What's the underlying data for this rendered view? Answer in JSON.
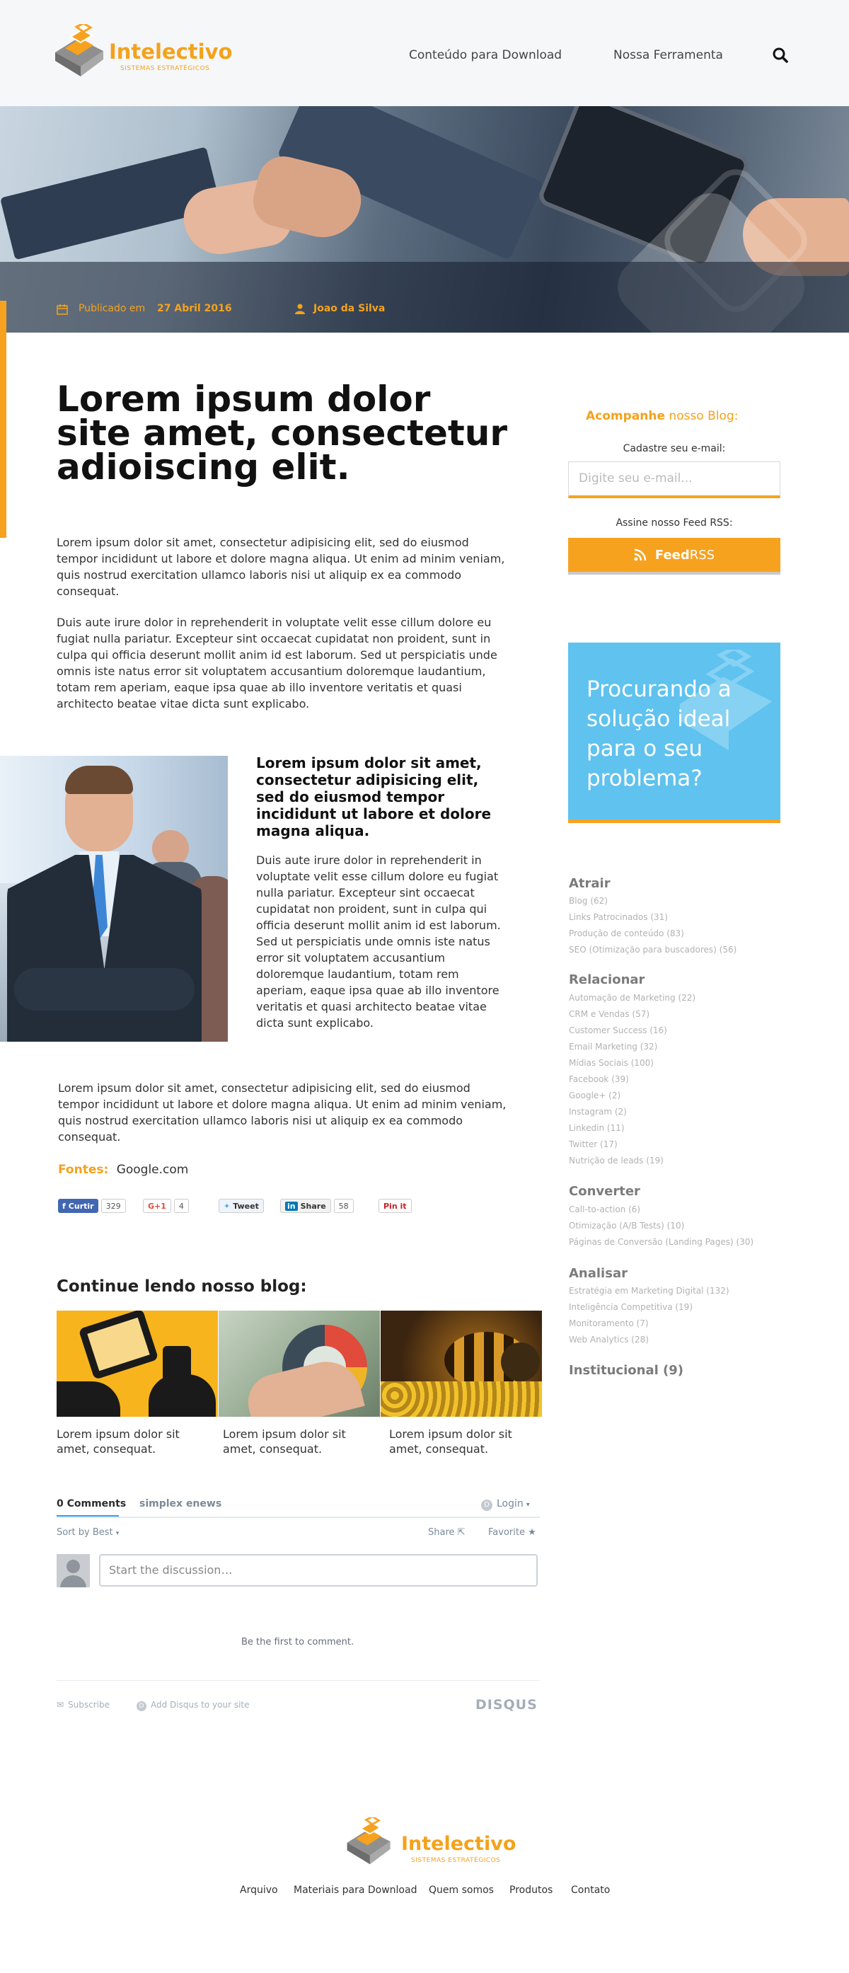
{
  "header": {
    "logo_name": "Intelectivo",
    "logo_tagline": "SISTEMAS ESTRATÉGICOS",
    "nav": [
      "Conteúdo para Download",
      "Nossa Ferramenta"
    ]
  },
  "hero": {
    "published_prefix": "Publicado em",
    "published_date": "27 Abril 2016",
    "author": "Joao da Silva"
  },
  "article": {
    "title_bold": "Lorem ipsum",
    "title_rest": " dolor site amet, consectetur adioiscing elit.",
    "p1": "Lorem ipsum dolor sit amet, consectetur adipisicing elit, sed do eiusmod tempor incididunt ut labore et dolore magna aliqua. Ut enim ad minim veniam, quis nostrud exercitation ullamco laboris nisi ut aliquip ex ea commodo consequat.",
    "p2": "Duis aute irure dolor in reprehenderit in voluptate velit esse cillum dolore eu fugiat nulla pariatur. Excepteur sint occaecat cupidatat non proident, sunt in culpa qui officia deserunt mollit anim id est laborum. Sed ut perspiciatis unde omnis iste natus error sit voluptatem accusantium doloremque laudantium, totam rem aperiam, eaque ipsa quae ab illo inventore veritatis et quasi architecto beatae vitae dicta sunt explicabo.",
    "lead": "Lorem ipsum dolor sit amet, consectetur adipisicing elit, sed do eiusmod tempor incididunt ut labore et dolore magna aliqua.",
    "p3": "Duis aute irure dolor in reprehenderit in voluptate velit esse cillum dolore eu fugiat nulla pariatur. Excepteur sint occaecat cupidatat non proident, sunt in culpa qui officia deserunt mollit anim id est laborum. Sed ut perspiciatis unde omnis iste natus error sit voluptatem accusantium doloremque laudantium, totam rem aperiam, eaque ipsa quae ab illo inventore veritatis et quasi architecto beatae vitae dicta sunt explicabo.",
    "p4": "Lorem ipsum dolor sit amet, consectetur adipisicing elit, sed do eiusmod tempor incididunt ut labore et dolore magna aliqua. Ut enim ad minim veniam, quis nostrud exercitation ullamco laboris nisi ut aliquip ex ea commodo consequat.",
    "sources_label": "Fontes:",
    "sources_value": "Google.com"
  },
  "social": {
    "facebook_label": "Curtir",
    "facebook_count": "329",
    "gplus_label": "G+1",
    "gplus_count": "4",
    "tweet_label": "Tweet",
    "linkedin_label": "Share",
    "linkedin_count": "58",
    "pinterest_label": "Pin it"
  },
  "related": {
    "heading": "Continue lendo nosso blog:",
    "captions": [
      "Lorem ipsum dolor sit amet, consequat.",
      "Lorem ipsum dolor sit amet, consequat.",
      "Lorem ipsum dolor sit amet, consequat."
    ]
  },
  "comments": {
    "tab_count": "0 Comments",
    "tab_site": "simplex enews",
    "login": "Login",
    "sort": "Sort by Best",
    "share": "Share",
    "favorite": "Favorite",
    "placeholder": "Start the discussion…",
    "empty": "Be the first to comment.",
    "subscribe": "Subscribe",
    "add_disqus": "Add Disqus to your site",
    "brand": "DISQUS"
  },
  "sidebar": {
    "follow_bold": "Acompanhe",
    "follow_rest": " nosso Blog:",
    "email_label": "Cadastre seu e-mail:",
    "email_placeholder": "Digite seu e-mail...",
    "rss_label": "Assine nosso Feed RSS:",
    "feed_bold": "Feed",
    "feed_rest": " RSS",
    "cta_text": "Procurando a solução ideal para o seu problema?",
    "categories": [
      {
        "title": "Atrair",
        "items": [
          "Blog (62)",
          "Links Patrocinados (31)",
          "Produção de conteúdo (83)",
          "SEO (Otimização para buscadores) (56)"
        ]
      },
      {
        "title": "Relacionar",
        "items": [
          "Automação de Marketing (22)",
          "CRM e Vendas (57)",
          "Customer Success (16)",
          "Email Marketing (32)",
          "Mídias Sociais (100)",
          "Facebook (39)",
          "Google+ (2)",
          "Instagram (2)",
          "Linkedin (11)",
          "Twitter (17)",
          "Nutrição de leads (19)"
        ]
      },
      {
        "title": "Converter",
        "items": [
          "Call-to-action (6)",
          "Otimização (A/B Tests) (10)",
          "Páginas de Conversão (Landing Pages) (30)"
        ]
      },
      {
        "title": "Analisar",
        "items": [
          "Estratégia em Marketing Digital (132)",
          "Inteligência Competitiva (19)",
          "Monitoramento (7)",
          "Web Analytics (28)"
        ]
      },
      {
        "title": "Institucional (9)",
        "items": []
      }
    ]
  },
  "footer": {
    "logo_name": "Intelectivo",
    "logo_tagline": "SISTEMAS ESTRATÉGICOS",
    "links": [
      "Arquivo",
      "Materiais para Download",
      "Quem somos",
      "Produtos",
      "Contato"
    ]
  },
  "colors": {
    "accent": "#f6a21f",
    "cta_blue": "#5fc2ef"
  }
}
